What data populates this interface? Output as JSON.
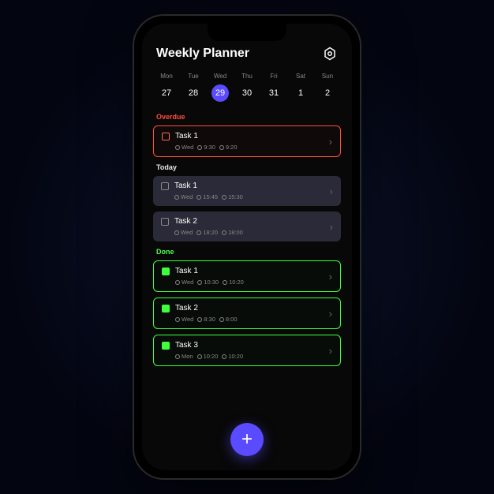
{
  "header": {
    "title": "Weekly Planner"
  },
  "colors": {
    "accent": "#5b4bff",
    "overdue": "#ff4d3d",
    "done": "#3dff3d"
  },
  "week": {
    "days": [
      {
        "label": "Mon",
        "num": "27",
        "selected": false
      },
      {
        "label": "Tue",
        "num": "28",
        "selected": false
      },
      {
        "label": "Wed",
        "num": "29",
        "selected": true
      },
      {
        "label": "Thu",
        "num": "30",
        "selected": false
      },
      {
        "label": "Fri",
        "num": "31",
        "selected": false
      },
      {
        "label": "Sat",
        "num": "1",
        "selected": false
      },
      {
        "label": "Sun",
        "num": "2",
        "selected": false
      }
    ]
  },
  "sections": {
    "overdue": {
      "label": "Overdue",
      "tasks": [
        {
          "name": "Task 1",
          "checked": false,
          "day": "Wed",
          "time1": "9:30",
          "time2": "9:20"
        }
      ]
    },
    "today": {
      "label": "Today",
      "tasks": [
        {
          "name": "Task 1",
          "checked": false,
          "day": "Wed",
          "time1": "15:45",
          "time2": "15:30"
        },
        {
          "name": "Task 2",
          "checked": false,
          "day": "Wed",
          "time1": "18:20",
          "time2": "18:00"
        }
      ]
    },
    "done": {
      "label": "Done",
      "tasks": [
        {
          "name": "Task 1",
          "checked": true,
          "day": "Wed",
          "time1": "10:30",
          "time2": "10:20"
        },
        {
          "name": "Task 2",
          "checked": true,
          "day": "Wed",
          "time1": "8:30",
          "time2": "8:00"
        },
        {
          "name": "Task 3",
          "checked": true,
          "day": "Mon",
          "time1": "10:20",
          "time2": "10:20"
        }
      ]
    }
  },
  "icons": {
    "chevron": "›",
    "plus": "+"
  }
}
